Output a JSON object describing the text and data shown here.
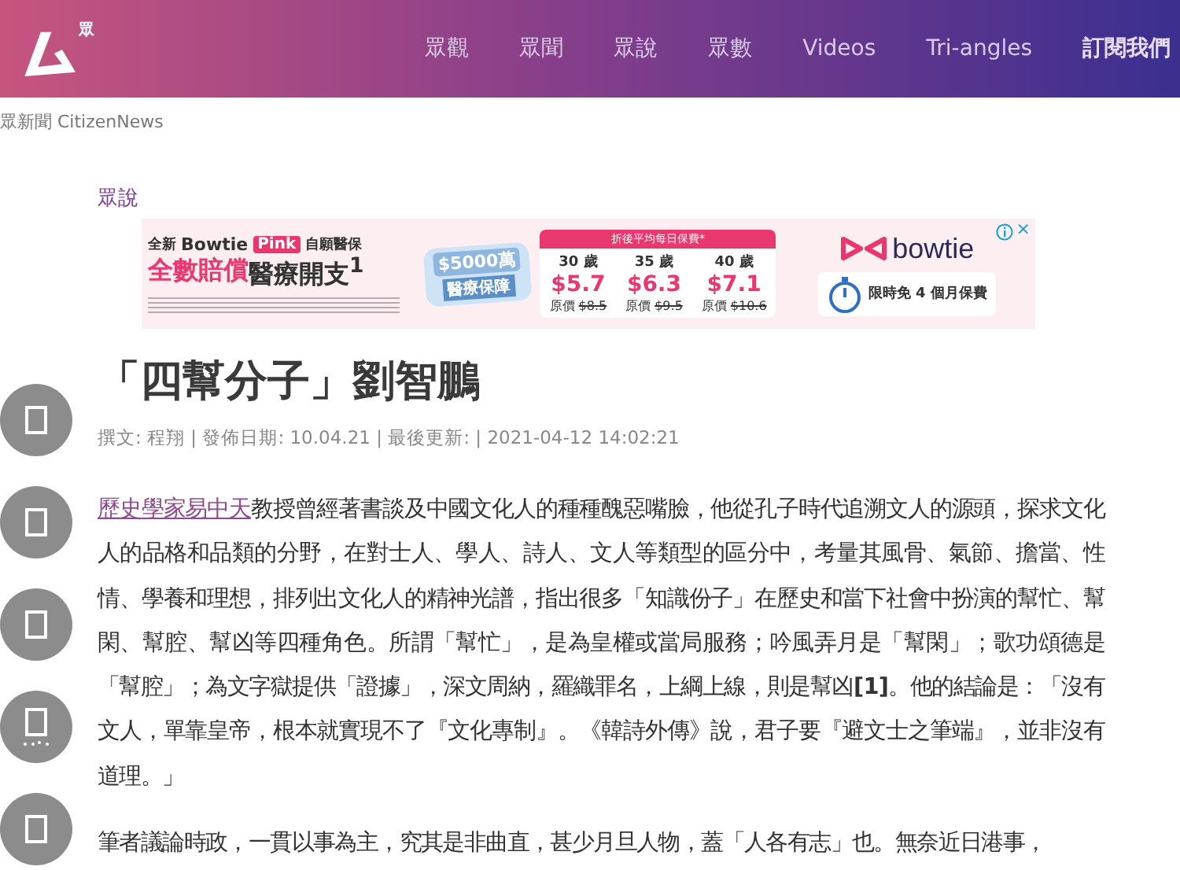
{
  "header": {
    "logo_badge": "眾",
    "nav": [
      {
        "label": "眾觀",
        "kind": "link"
      },
      {
        "label": "眾聞",
        "kind": "link"
      },
      {
        "label": "眾說",
        "kind": "link"
      },
      {
        "label": "眾數",
        "kind": "link"
      },
      {
        "label": "Videos",
        "kind": "link"
      },
      {
        "label": "Tri-angles",
        "kind": "link"
      },
      {
        "label": "訂閱我們",
        "kind": "cta"
      }
    ]
  },
  "breadcrumb": "眾新聞 CitizenNews",
  "category": "眾說",
  "ad": {
    "new": "全新",
    "brand": "Bowtie",
    "pink": "Pink",
    "product": "自願醫保",
    "headline_a": "全數賠償",
    "headline_b": "醫療開支$^{1}$",
    "badge_amount": "$5000萬",
    "badge_label": "醫療保障",
    "table_title": "折後平均每日保費*",
    "prices": [
      {
        "age": "30 歲",
        "price": "$5.7",
        "orig_label": "原價",
        "orig": "$8.5"
      },
      {
        "age": "35 歲",
        "price": "$6.3",
        "orig_label": "原價",
        "orig": "$9.5"
      },
      {
        "age": "40 歲",
        "price": "$7.1",
        "orig_label": "原價",
        "orig": "$10.6"
      }
    ],
    "logo": "bowtie",
    "offer": "限時免 4 個月保費",
    "close": "×"
  },
  "article": {
    "title": "「四幫分子」劉智鵬",
    "meta": "撰文: 程翔 | 發佈日期: 10.04.21 | 最後更新: | 2021-04-12 14:02:21",
    "paragraphs": [
      {
        "link": "歷史學家易中天",
        "text": "教授曾經著書談及中國文化人的種種醜惡嘴臉，他從孔子時代追溯文人的源頭，探求文化人的品格和品類的分野，在對士人、學人、詩人、文人等類型的區分中，考量其風骨、氣節、擔當、性情、學養和理想，排列出文化人的精神光譜，指出很多「知識份子」在歷史和當下社會中扮演的幫忙、幫閑、幫腔、幫凶等四種角色。所謂「幫忙」，是為皇權或當局服務；吟風弄月是「幫閑」；歌功頌德是「幫腔」；為文字獄提供「證據」，深文周納，羅織罪名，上綱上線，則是幫凶**[1]**。他的結論是：「沒有文人，單靠皇帝，根本就實現不了『文化專制』。《韓詩外傳》說，君子要『避文士之筆端』，並非沒有道理。」"
      },
      {
        "text": "筆者議論時政，一貫以事為主，究其是非曲直，甚少月旦人物，蓋「人各有志」也。無奈近日港事，"
      }
    ]
  }
}
